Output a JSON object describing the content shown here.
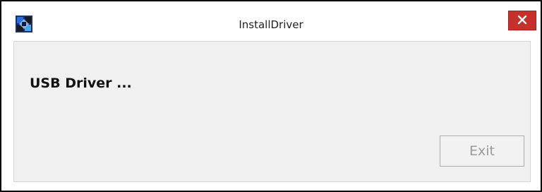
{
  "window": {
    "title": "InstallDriver",
    "app_icon": "installer-app-icon",
    "close_icon": "close-icon",
    "close_color": "#c7302b"
  },
  "content": {
    "message": "USB Driver ...",
    "exit_label": "Exit",
    "exit_enabled": false
  }
}
